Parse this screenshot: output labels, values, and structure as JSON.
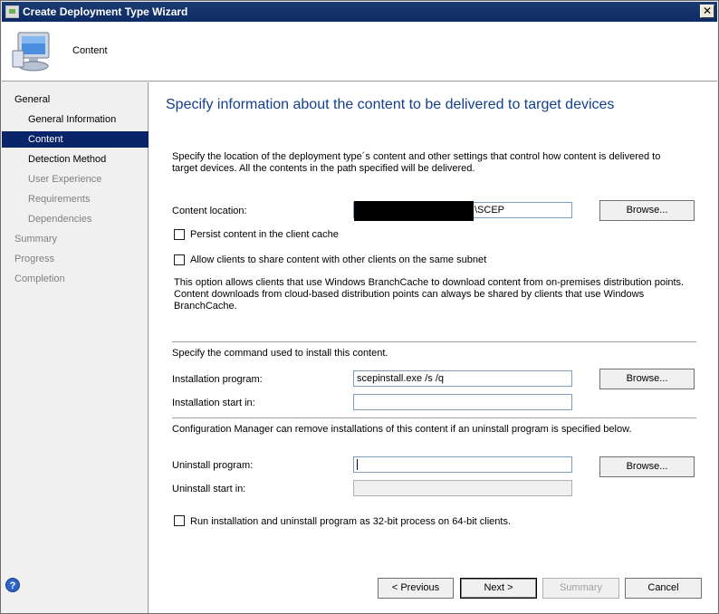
{
  "window": {
    "title": "Create Deployment Type Wizard",
    "close": "✕"
  },
  "header": {
    "title": "Content",
    "icon": "computer-icon"
  },
  "sidebar": {
    "items": [
      {
        "label": "General",
        "level": 1,
        "state": "normal"
      },
      {
        "label": "General Information",
        "level": 2,
        "state": "normal"
      },
      {
        "label": "Content",
        "level": 2,
        "state": "active"
      },
      {
        "label": "Detection Method",
        "level": 2,
        "state": "normal"
      },
      {
        "label": "User Experience",
        "level": 2,
        "state": "disabled"
      },
      {
        "label": "Requirements",
        "level": 2,
        "state": "disabled"
      },
      {
        "label": "Dependencies",
        "level": 2,
        "state": "disabled"
      },
      {
        "label": "Summary",
        "level": 1,
        "state": "disabled"
      },
      {
        "label": "Progress",
        "level": 1,
        "state": "disabled"
      },
      {
        "label": "Completion",
        "level": 1,
        "state": "disabled"
      }
    ]
  },
  "main": {
    "heading": "Specify information about the content to be delivered to target devices",
    "description": "Specify the location of the deployment type´s content and other settings that control how content is delivered to target devices. All the contents in the path specified will be delivered.",
    "content_location": {
      "label": "Content location:",
      "value": "\\SCEP",
      "browse": "Browse..."
    },
    "persist_cache": {
      "label": "Persist content in the client cache",
      "checked": false
    },
    "allow_share": {
      "label": "Allow clients to share content with other clients on the same subnet",
      "checked": false
    },
    "branchcache_note": "This option allows clients that use Windows BranchCache to download content from on-premises distribution points. Content downloads from cloud-based distribution points can always be shared by clients that use Windows BranchCache.",
    "install_section": "Specify the command used to install this content.",
    "install_program": {
      "label": "Installation program:",
      "value": "scepinstall.exe /s /q",
      "browse": "Browse..."
    },
    "install_start": {
      "label": "Installation start in:",
      "value": ""
    },
    "uninstall_section": "Configuration Manager can remove installations of this content if an uninstall program is specified below.",
    "uninstall_program": {
      "label": "Uninstall program:",
      "value": "",
      "browse": "Browse..."
    },
    "uninstall_start": {
      "label": "Uninstall start in:",
      "value": ""
    },
    "run_32bit": {
      "label": "Run installation and uninstall program as 32-bit process on 64-bit clients.",
      "checked": false
    }
  },
  "footer": {
    "help": "?",
    "previous": "< Previous",
    "next": "Next >",
    "summary": "Summary",
    "cancel": "Cancel"
  }
}
